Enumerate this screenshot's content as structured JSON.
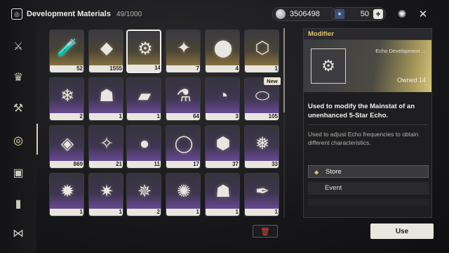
{
  "header": {
    "title": "Development Materials",
    "capacity": "49/1000",
    "currency_shell": "3506498",
    "currency_waveplate": "50",
    "plus_label": "+"
  },
  "grid": {
    "items": [
      {
        "qty": "52"
      },
      {
        "qty": "1555"
      },
      {
        "qty": "14"
      },
      {
        "qty": "7"
      },
      {
        "qty": "4"
      },
      {
        "qty": "1"
      },
      {
        "qty": "2"
      },
      {
        "qty": "1"
      },
      {
        "qty": "1"
      },
      {
        "qty": "64"
      },
      {
        "qty": "3"
      },
      {
        "qty": "105"
      },
      {
        "qty": "869"
      },
      {
        "qty": "21"
      },
      {
        "qty": "11"
      },
      {
        "qty": "17"
      },
      {
        "qty": "37"
      },
      {
        "qty": "33"
      },
      {
        "qty": "1"
      },
      {
        "qty": "1"
      },
      {
        "qty": "2"
      },
      {
        "qty": "1"
      },
      {
        "qty": "1"
      },
      {
        "qty": "1"
      }
    ],
    "new_badge": "New"
  },
  "detail": {
    "category": "Modifier",
    "subtitle": "Echo Development ...",
    "owned": "Owned 14",
    "main_text": "Used to modify the Mainstat of an unenhanced 5-Star Echo.",
    "description": "Used to adjust Echo frequencies to obtain different characteristics.",
    "sources": [
      "Store",
      "Event"
    ]
  },
  "actions": {
    "use_label": "Use"
  },
  "colors": {
    "accent_gold": "#e2c66f",
    "rarity_gold": "#8a7440",
    "rarity_purple": "#6b4b98",
    "trash_red": "#e04a3c"
  }
}
